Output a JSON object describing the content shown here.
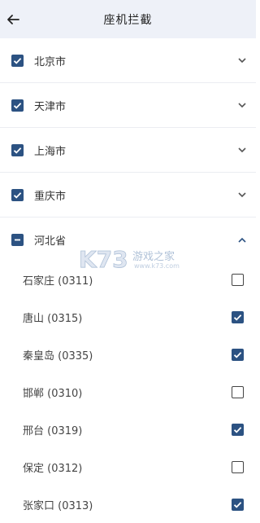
{
  "header": {
    "title": "座机拦截",
    "back_icon": "arrow-left-icon"
  },
  "colors": {
    "accent": "#2c5282",
    "header_bg": "#eef1f8"
  },
  "provinces": [
    {
      "label": "北京市",
      "state": "checked",
      "expanded": false
    },
    {
      "label": "天津市",
      "state": "checked",
      "expanded": false
    },
    {
      "label": "上海市",
      "state": "checked",
      "expanded": false
    },
    {
      "label": "重庆市",
      "state": "checked",
      "expanded": false
    },
    {
      "label": "河北省",
      "state": "partial",
      "expanded": true
    }
  ],
  "cities": [
    {
      "label": "石家庄 (0311)",
      "checked": false
    },
    {
      "label": "唐山 (0315)",
      "checked": true
    },
    {
      "label": "秦皇岛 (0335)",
      "checked": true
    },
    {
      "label": "邯郸 (0310)",
      "checked": false
    },
    {
      "label": "邢台 (0319)",
      "checked": true
    },
    {
      "label": "保定 (0312)",
      "checked": false
    },
    {
      "label": "张家口 (0313)",
      "checked": true
    }
  ],
  "watermark": {
    "text": "游戏之家",
    "url": "www.k73.com"
  }
}
